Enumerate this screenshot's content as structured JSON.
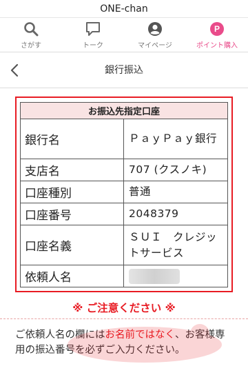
{
  "app": {
    "title": "ONE-chan"
  },
  "nav": {
    "search": "さがす",
    "talk": "トーク",
    "mypage": "マイページ",
    "points": "ポイント購入",
    "points_badge": "P"
  },
  "header": {
    "title": "銀行振込"
  },
  "account": {
    "heading": "お振込先指定口座",
    "rows": [
      {
        "label": "銀行名",
        "value": "ＰａｙＰａｙ銀行"
      },
      {
        "label": "支店名",
        "value": "707 (クスノキ)"
      },
      {
        "label": "口座種別",
        "value": "普通"
      },
      {
        "label": "口座番号",
        "value": "2048379"
      },
      {
        "label": "口座名義",
        "value": "ＳＵＩ　クレジットサービス"
      },
      {
        "label": "依頼人名",
        "value": ""
      }
    ]
  },
  "notice": {
    "title": "※ ご注意ください ※",
    "text_1": "ご依頼人名の欄には",
    "text_emph": "お名前ではなく",
    "text_2": "、お客様専用の振込番号を必ずご入力ください。"
  },
  "colors": {
    "accent": "#e81b23",
    "brand_pink": "#e94b8a",
    "table_head_bg": "#f9e3e3"
  }
}
